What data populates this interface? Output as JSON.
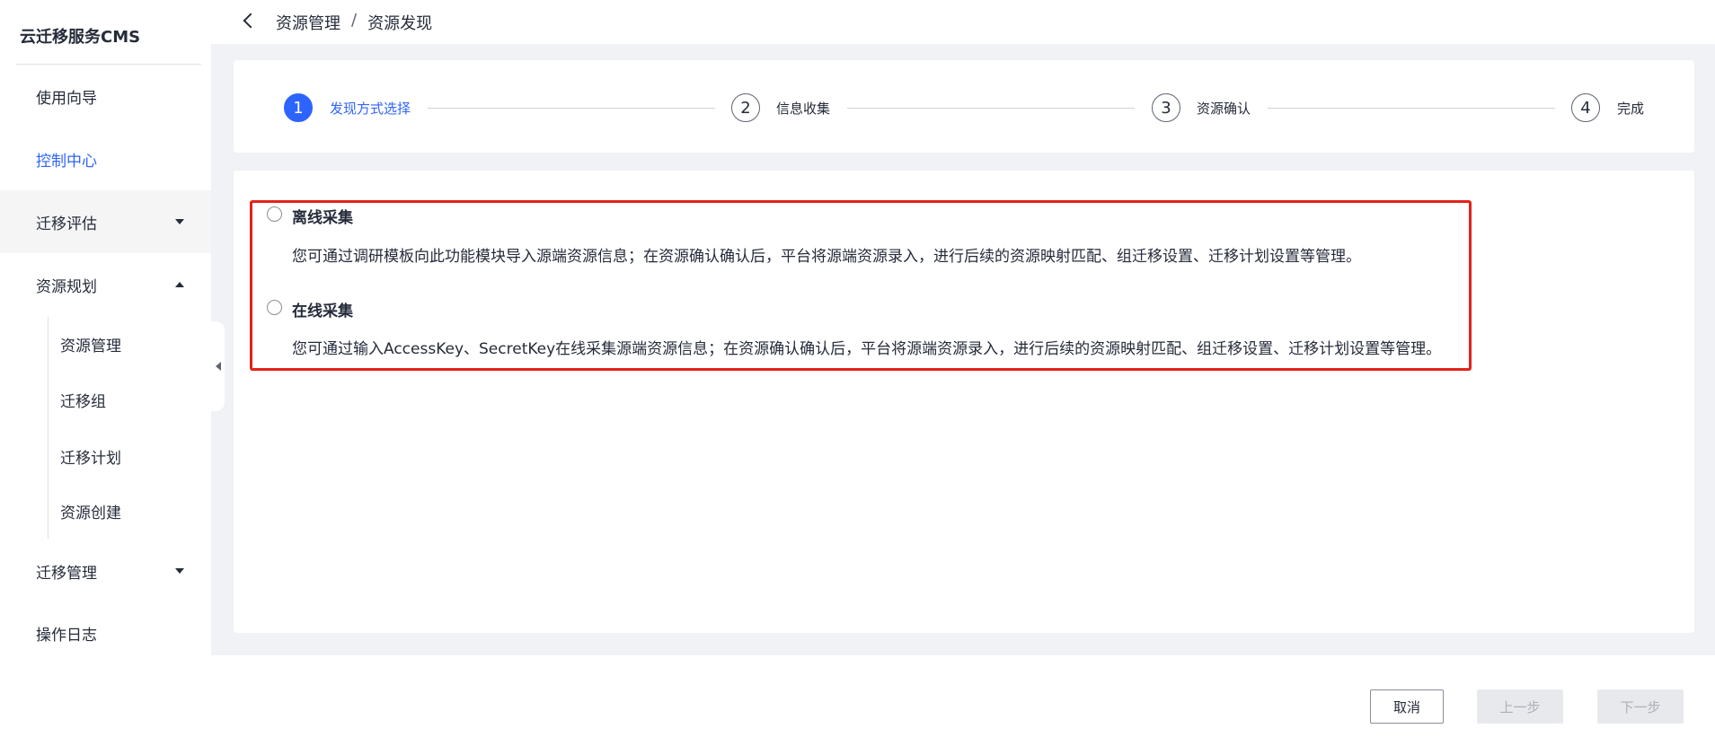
{
  "app": {
    "title": "云迁移服务CMS"
  },
  "sidebar": {
    "items": [
      {
        "label": "使用向导"
      },
      {
        "label": "控制中心"
      },
      {
        "label": "迁移评估"
      },
      {
        "label": "资源规划"
      },
      {
        "label": "迁移管理"
      },
      {
        "label": "操作日志"
      }
    ],
    "subitems": [
      {
        "label": "资源管理"
      },
      {
        "label": "迁移组"
      },
      {
        "label": "迁移计划"
      },
      {
        "label": "资源创建"
      }
    ]
  },
  "breadcrumb": {
    "parent": "资源管理",
    "separator": "/",
    "current": "资源发现"
  },
  "steps": [
    {
      "number": "1",
      "label": "发现方式选择"
    },
    {
      "number": "2",
      "label": "信息收集"
    },
    {
      "number": "3",
      "label": "资源确认"
    },
    {
      "number": "4",
      "label": "完成"
    }
  ],
  "current_step": 1,
  "options": [
    {
      "title": "离线采集",
      "description": "您可通过调研模板向此功能模块导入源端资源信息；在资源确认确认后，平台将源端资源录入，进行后续的资源映射匹配、组迁移设置、迁移计划设置等管理。"
    },
    {
      "title": "在线采集",
      "description": "您可通过输入AccessKey、SecretKey在线采集源端资源信息；在资源确认确认后，平台将源端资源录入，进行后续的资源映射匹配、组迁移设置、迁移计划设置等管理。"
    }
  ],
  "footer": {
    "cancel": "取消",
    "prev": "上一步",
    "next": "下一步"
  },
  "colors": {
    "accent": "#2e64fe",
    "highlight": "#e32219"
  }
}
